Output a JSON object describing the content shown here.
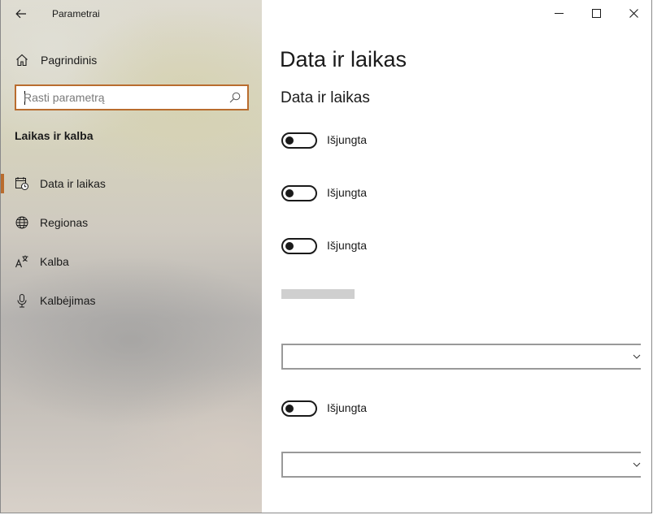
{
  "window": {
    "title": "Parametrai"
  },
  "sidebar": {
    "home_label": "Pagrindinis",
    "search": {
      "placeholder": "Rasti parametrą",
      "value": ""
    },
    "section_title": "Laikas ir kalba",
    "items": [
      {
        "label": "Data ir laikas",
        "icon": "calendar-clock-icon",
        "selected": true
      },
      {
        "label": "Regionas",
        "icon": "globe-icon",
        "selected": false
      },
      {
        "label": "Kalba",
        "icon": "language-icon",
        "selected": false
      },
      {
        "label": "Kalbėjimas",
        "icon": "microphone-icon",
        "selected": false
      }
    ]
  },
  "main": {
    "page_title": "Data ir laikas",
    "section_title": "Data ir laikas",
    "toggles": [
      {
        "state_label": "Išjungta",
        "on": false
      },
      {
        "state_label": "Išjungta",
        "on": false
      },
      {
        "state_label": "Išjungta",
        "on": false
      },
      {
        "state_label": "Išjungta",
        "on": false
      }
    ],
    "dropdowns": [
      {
        "value": ""
      },
      {
        "value": ""
      }
    ]
  },
  "colors": {
    "accent": "#b96c2e",
    "text": "#1a1a1a"
  }
}
